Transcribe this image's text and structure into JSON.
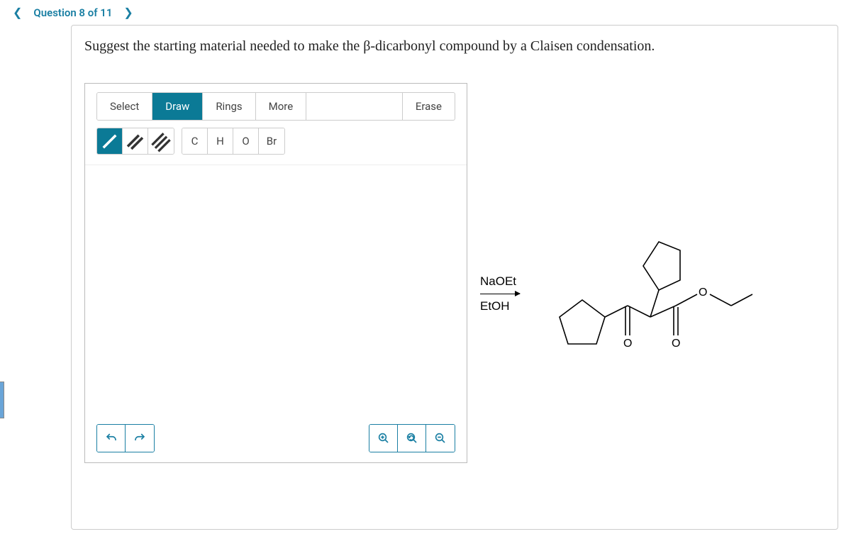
{
  "nav": {
    "question_label": "Question 8 of 11"
  },
  "prompt": "Suggest the starting material needed to make the β-dicarbonyl compound by a Claisen condensation.",
  "tabs": {
    "select": "Select",
    "draw": "Draw",
    "rings": "Rings",
    "more": "More",
    "erase": "Erase"
  },
  "bonds": {
    "single": "/",
    "double": "//",
    "triple": "///"
  },
  "elements": {
    "c": "C",
    "h": "H",
    "o": "O",
    "br": "Br"
  },
  "reaction": {
    "reagent_top": "NaOEt",
    "reagent_bottom": "EtOH"
  }
}
